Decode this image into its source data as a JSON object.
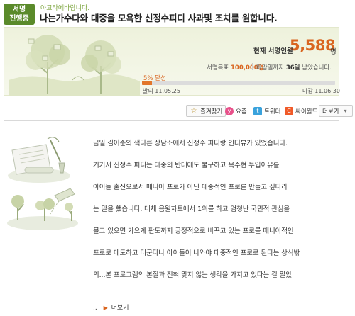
{
  "status_badge": {
    "line1": "서명",
    "line2": "진행중"
  },
  "brand": "아고라에바랍니다.",
  "title": "나는가수다와 대중을 모욕한 신정수피디 사과및 조치를 원합니다.",
  "stats": {
    "current_label": "현재 서명인원",
    "current_count": "5,588",
    "current_unit": "명",
    "goal_label": "서명목표",
    "goal_value": "100,000명",
    "deadline_label": "마감일까지",
    "deadline_days": "36일",
    "deadline_suffix": "남았습니다.",
    "progress_label": "5% 달성",
    "progress_fraction": 0.05,
    "start_prefix": "발의",
    "start_date": "11.05.25",
    "end_prefix": "마감",
    "end_date": "11.06.30"
  },
  "share": {
    "bookmark": "즐겨찾기",
    "yozm": "요즘",
    "twitter": "트위터",
    "cyworld": "싸이월드",
    "more": "더보기"
  },
  "body_lines": [
    "금일 김어준의 색다른 상담소에서 신정수 피디랑 인터뷰가 있었습니다.",
    "거기서 신정수 피디는 대중의 반대에도 불구하고 옥주현 투입이유를",
    "아이돌 출신으로서 매니아 프로가 아닌 대중적인 프로를 만들고 싶다라",
    "는 말을 했습니다. 대체 음원차트에서 1위를 하고 엄청난 국민적 관심을",
    "몰고 있으면 가요계 판도까지 긍정적으로 바꾸고 있는 프로를 매니아적인",
    "프로로 매도하고 더군다나 아이돌이 나와야 대중적인 프로로 된다는 상식밖",
    "의...본 프로그램의 본질과 전혀 맞지 않는 생각을 가지고 있다는 걸 알았"
  ],
  "read_more": {
    "ellipsis": "..",
    "label": "더보기"
  },
  "colors": {
    "accent": "#d9651f",
    "badge": "#5a8a2a",
    "progress_fill": "#e2762a"
  }
}
